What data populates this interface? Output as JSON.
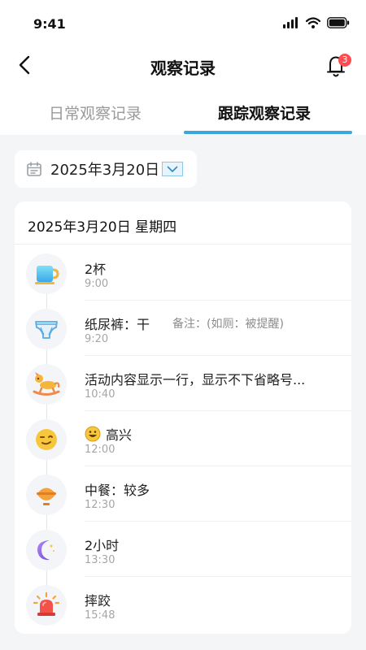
{
  "status": {
    "time": "9:41"
  },
  "nav": {
    "title": "观察记录",
    "badge": "3"
  },
  "tabs": [
    {
      "label": "日常观察记录"
    },
    {
      "label": "跟踪观察记录"
    }
  ],
  "filter": {
    "date": "2025年3月20日"
  },
  "card": {
    "heading": "2025年3月20日  星期四",
    "items": [
      {
        "title": "2杯",
        "time": "9:00",
        "icon": "cup-icon"
      },
      {
        "title": "纸尿裤：干",
        "note": "备注：(如厕：被提醒)",
        "time": "9:20",
        "icon": "diaper-icon"
      },
      {
        "title": "活动内容显示一行，显示不下省略号...",
        "time": "10:40",
        "icon": "rocking-horse-icon"
      },
      {
        "title": "高兴",
        "time": "12:00",
        "icon": "smile-face-icon",
        "title_icon": "happy-emoji-icon"
      },
      {
        "title": "中餐：较多",
        "time": "12:30",
        "icon": "meal-bowl-icon"
      },
      {
        "title": "2小时",
        "time": "13:30",
        "icon": "moon-icon"
      },
      {
        "title": "摔跤",
        "time": "15:48",
        "icon": "alarm-light-icon"
      }
    ]
  }
}
